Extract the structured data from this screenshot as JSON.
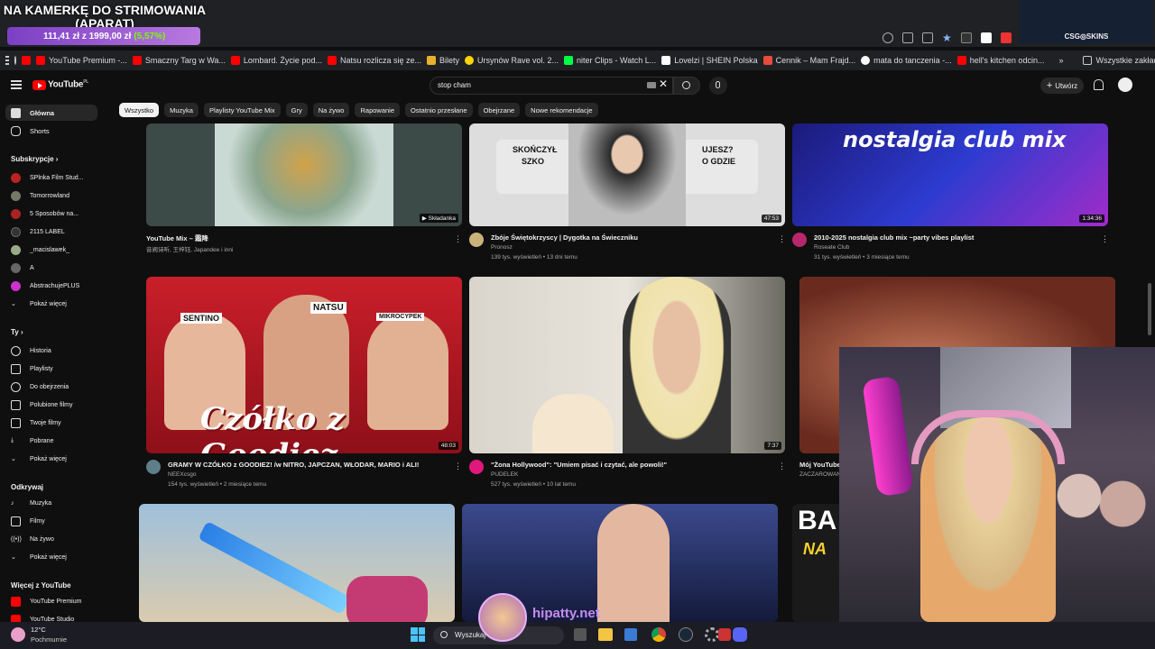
{
  "stream": {
    "banner_title": "NA KAMERKĘ DO STRIMOWANIA (APARAT)",
    "price_now": "111,41 zł",
    "price_sep": "z",
    "price_goal": "1999,00 zł",
    "price_pct": "(5,57%)",
    "sponsor": "CSG◎SKINS",
    "watermark": "hipatty.net"
  },
  "bookmarks": [
    {
      "label": "YouTube Premium -...",
      "color": "#ff0000"
    },
    {
      "label": "Smaczny Targ w Wa...",
      "color": "#ff0000"
    },
    {
      "label": "Lombard. Życie pod...",
      "color": "#ff0000"
    },
    {
      "label": "Natsu rozlicza się ze...",
      "color": "#ff0000"
    },
    {
      "label": "Bilety",
      "color": "#e8b02c"
    },
    {
      "label": "Ursynów Rave vol. 2...",
      "color": "#ffd400"
    },
    {
      "label": "niter Clips - Watch L...",
      "color": "#00ff44"
    },
    {
      "label": "Lovelzi | SHEIN Polska",
      "color": "#ffffff"
    },
    {
      "label": "Cennik – Mam Frajd...",
      "color": "#e74c3c"
    },
    {
      "label": "mata do tanczenia -...",
      "color": "#ffffff"
    },
    {
      "label": "hell's kitchen odcin...",
      "color": "#ff0000"
    }
  ],
  "bookmarks_all": "Wszystkie zakładki",
  "header": {
    "logo": "YouTube",
    "logo_region": "PL",
    "search_value": "stop cham",
    "create_label": "Utwórz"
  },
  "chips": [
    "Wszystko",
    "Muzyka",
    "Playlisty YouTube Mix",
    "Gry",
    "Na żywo",
    "Rapowanie",
    "Ostatnio przesłane",
    "Obejrzane",
    "Nowe rekomendacje"
  ],
  "sidebar": {
    "main": [
      {
        "label": "Główna",
        "icon": "home-icon"
      },
      {
        "label": "Shorts",
        "icon": "shorts-icon"
      }
    ],
    "subs_head": "Subskrypcje",
    "subs": [
      {
        "label": "SPlnka Film Stud...",
        "color": "#b22"
      },
      {
        "label": "Tomorrowland",
        "color": "#776"
      },
      {
        "label": "5 Sposobów na...",
        "color": "#a22"
      },
      {
        "label": "2115 LABEL",
        "color": "#333"
      },
      {
        "label": "_macislawek_",
        "color": "#9a8"
      },
      {
        "label": "A",
        "color": "#666"
      },
      {
        "label": "AbstrachujePLUS",
        "color": "#c3c"
      }
    ],
    "subs_more": "Pokaż więcej",
    "you_head": "Ty",
    "you": [
      {
        "label": "Historia",
        "icon": "history-icon"
      },
      {
        "label": "Playlisty",
        "icon": "playlist-icon"
      },
      {
        "label": "Do obejrzenia",
        "icon": "watch-later-icon"
      },
      {
        "label": "Polubione filmy",
        "icon": "like-icon"
      },
      {
        "label": "Twoje filmy",
        "icon": "your-videos-icon"
      },
      {
        "label": "Pobrane",
        "icon": "download-icon"
      }
    ],
    "you_more": "Pokaż więcej",
    "explore_head": "Odkrywaj",
    "explore": [
      {
        "label": "Muzyka",
        "icon": "music-icon"
      },
      {
        "label": "Filmy",
        "icon": "film-icon"
      },
      {
        "label": "Na żywo",
        "icon": "live-icon"
      }
    ],
    "explore_more": "Pokaż więcej",
    "more_head": "Więcej z YouTube",
    "more": [
      {
        "label": "YouTube Premium"
      },
      {
        "label": "YouTube Studio"
      }
    ]
  },
  "videos": [
    {
      "title": "YouTube Mix – 霜降",
      "meta1": "音阙诗听, 王梓钰, Japandee i inni",
      "meta2": "",
      "dur": "▶ Składanka"
    },
    {
      "title": "Zbóje Świętokrzyscy | Dygotka na Świeczniku",
      "meta1": "Pronosz",
      "meta2": "139 tys. wyświetleń • 13 dni temu",
      "dur": "47:53"
    },
    {
      "title": "2010-2025 nostalgia club mix ~party vibes playlist",
      "meta1": "Roseate Club",
      "meta2": "31 tys. wyświetleń • 3 miesiące temu",
      "dur": "1:34:36",
      "overlay": "nostalgia club mix"
    },
    {
      "title": "GRAMY W CZÓŁKO z GOODIEZ! /w NITRO, JAPCZAN, WŁODAR, MARIO i ALI!",
      "meta1": "NEEXcsgo",
      "meta2": "154 tys. wyświetleń • 2 miesiące temu",
      "dur": "48:03",
      "overlay": "Czółko z Goodiez"
    },
    {
      "title": "\"Żona Hollywood\": \"Umiem pisać i czytać, ale powoli!\"",
      "meta1": "PUDELEK",
      "meta2": "527 tys. wyświetleń • 10 lat temu",
      "dur": "7:37"
    },
    {
      "title": "Mój YouTube",
      "meta1": "ZACZAROWAN",
      "meta2": "",
      "dur": ""
    }
  ],
  "thumb_text": {
    "sentino": "SENTINO",
    "natsu": "NATSU",
    "mikro": "MIKROCYPEK",
    "cut1": "SKOŃCZYŁ",
    "cut2": "SZKO",
    "cut3": "UJESZ?",
    "cut4": "O GDZIE",
    "ba": "BA",
    "na": "NA"
  },
  "taskbar": {
    "temp": "12°C",
    "weather": "Pochmurnie",
    "search": "Wyszukaj"
  }
}
